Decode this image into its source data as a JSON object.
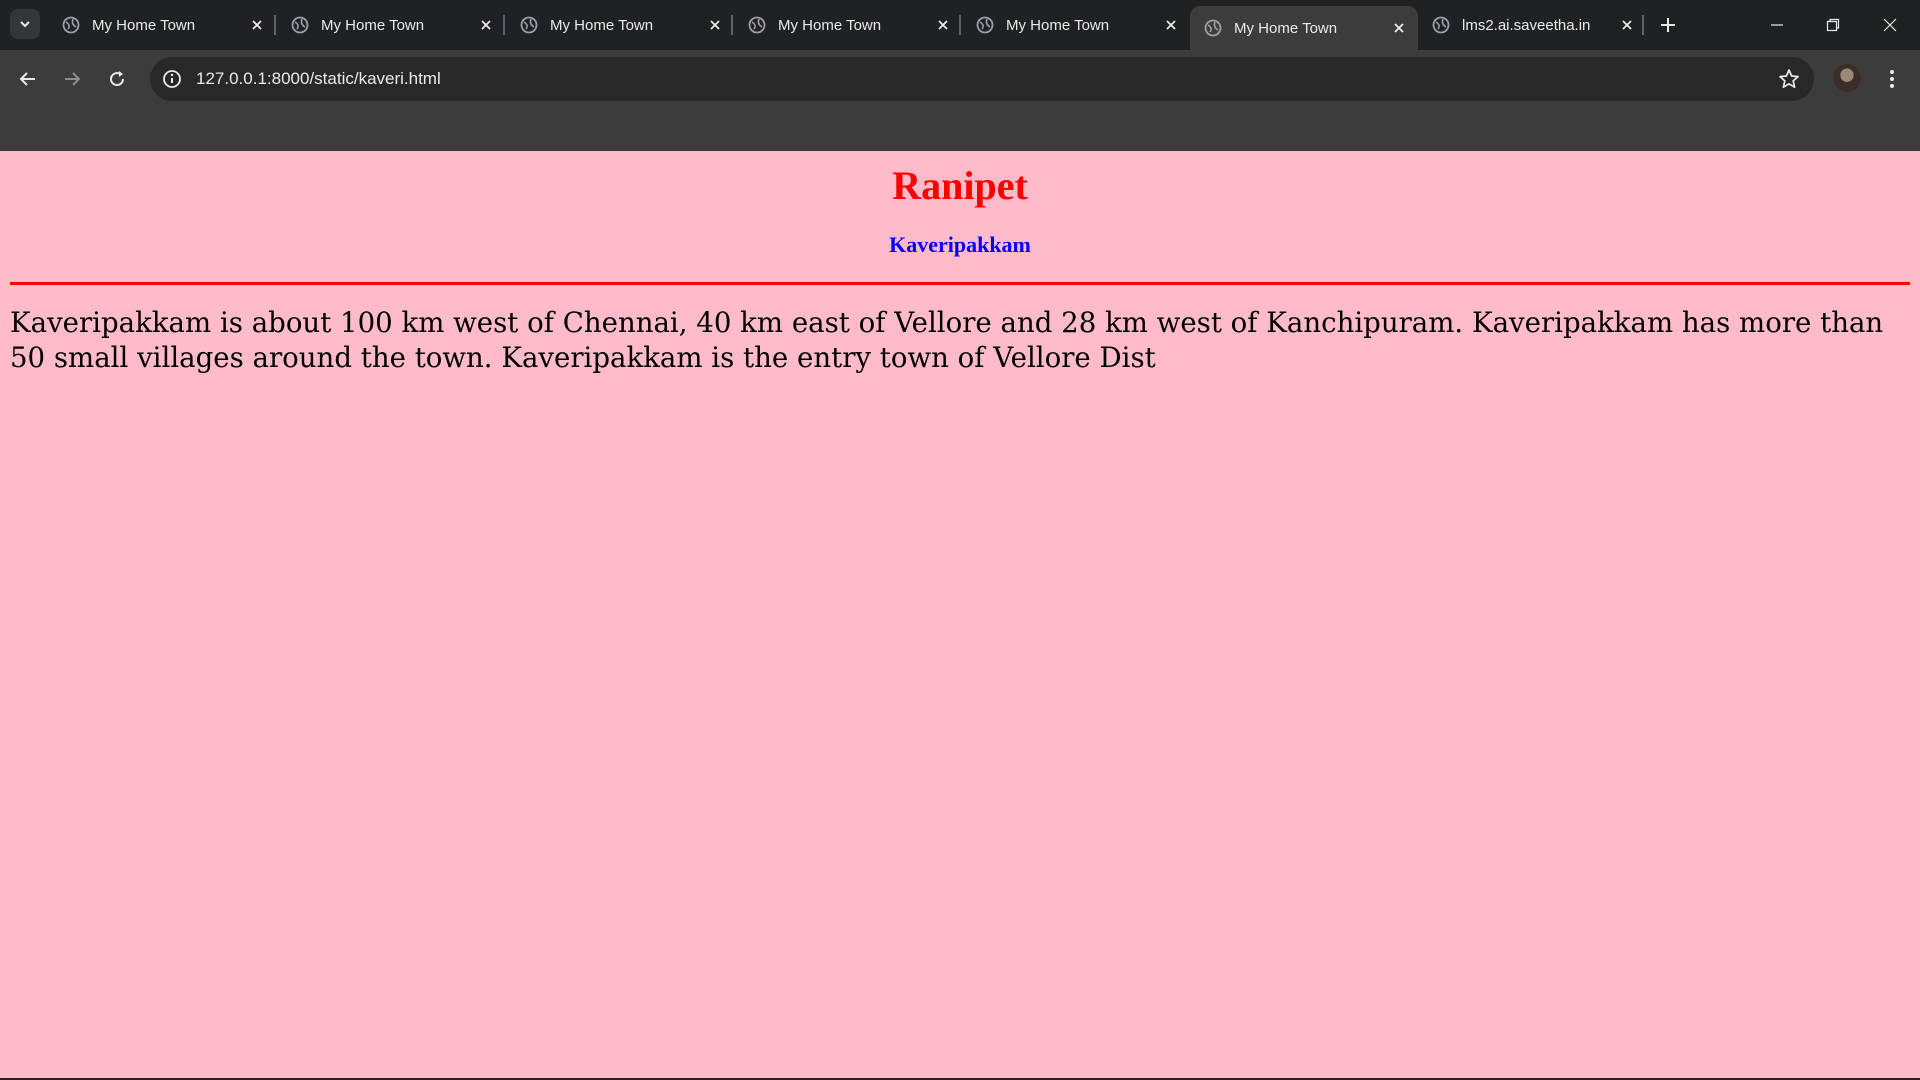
{
  "browser": {
    "tabs": [
      {
        "title": "My Home Town",
        "active": false
      },
      {
        "title": "My Home Town",
        "active": false
      },
      {
        "title": "My Home Town",
        "active": false
      },
      {
        "title": "My Home Town",
        "active": false
      },
      {
        "title": "My Home Town",
        "active": false
      },
      {
        "title": "My Home Town",
        "active": true
      },
      {
        "title": "lms2.ai.saveetha.in",
        "active": false
      }
    ],
    "url": "127.0.0.1:8000/static/kaveri.html",
    "colors": {
      "tabstrip": "#202124",
      "toolbar": "#3c3c3c",
      "omnibox": "#282828"
    }
  },
  "page": {
    "title": "Ranipet",
    "subtitle": "Kaveripakkam",
    "body": "Kaveripakkam is about 100 km west of Chennai, 40 km east of Vellore and 28 km west of Kanchipuram. Kaveripakkam has more than 50 small villages around the town. Kaveripakkam is the entry town of Vellore Dist",
    "colors": {
      "background": "#ffbbca",
      "title": "#ff0000",
      "subtitle": "#0000ff",
      "rule": "#ff0000"
    }
  }
}
